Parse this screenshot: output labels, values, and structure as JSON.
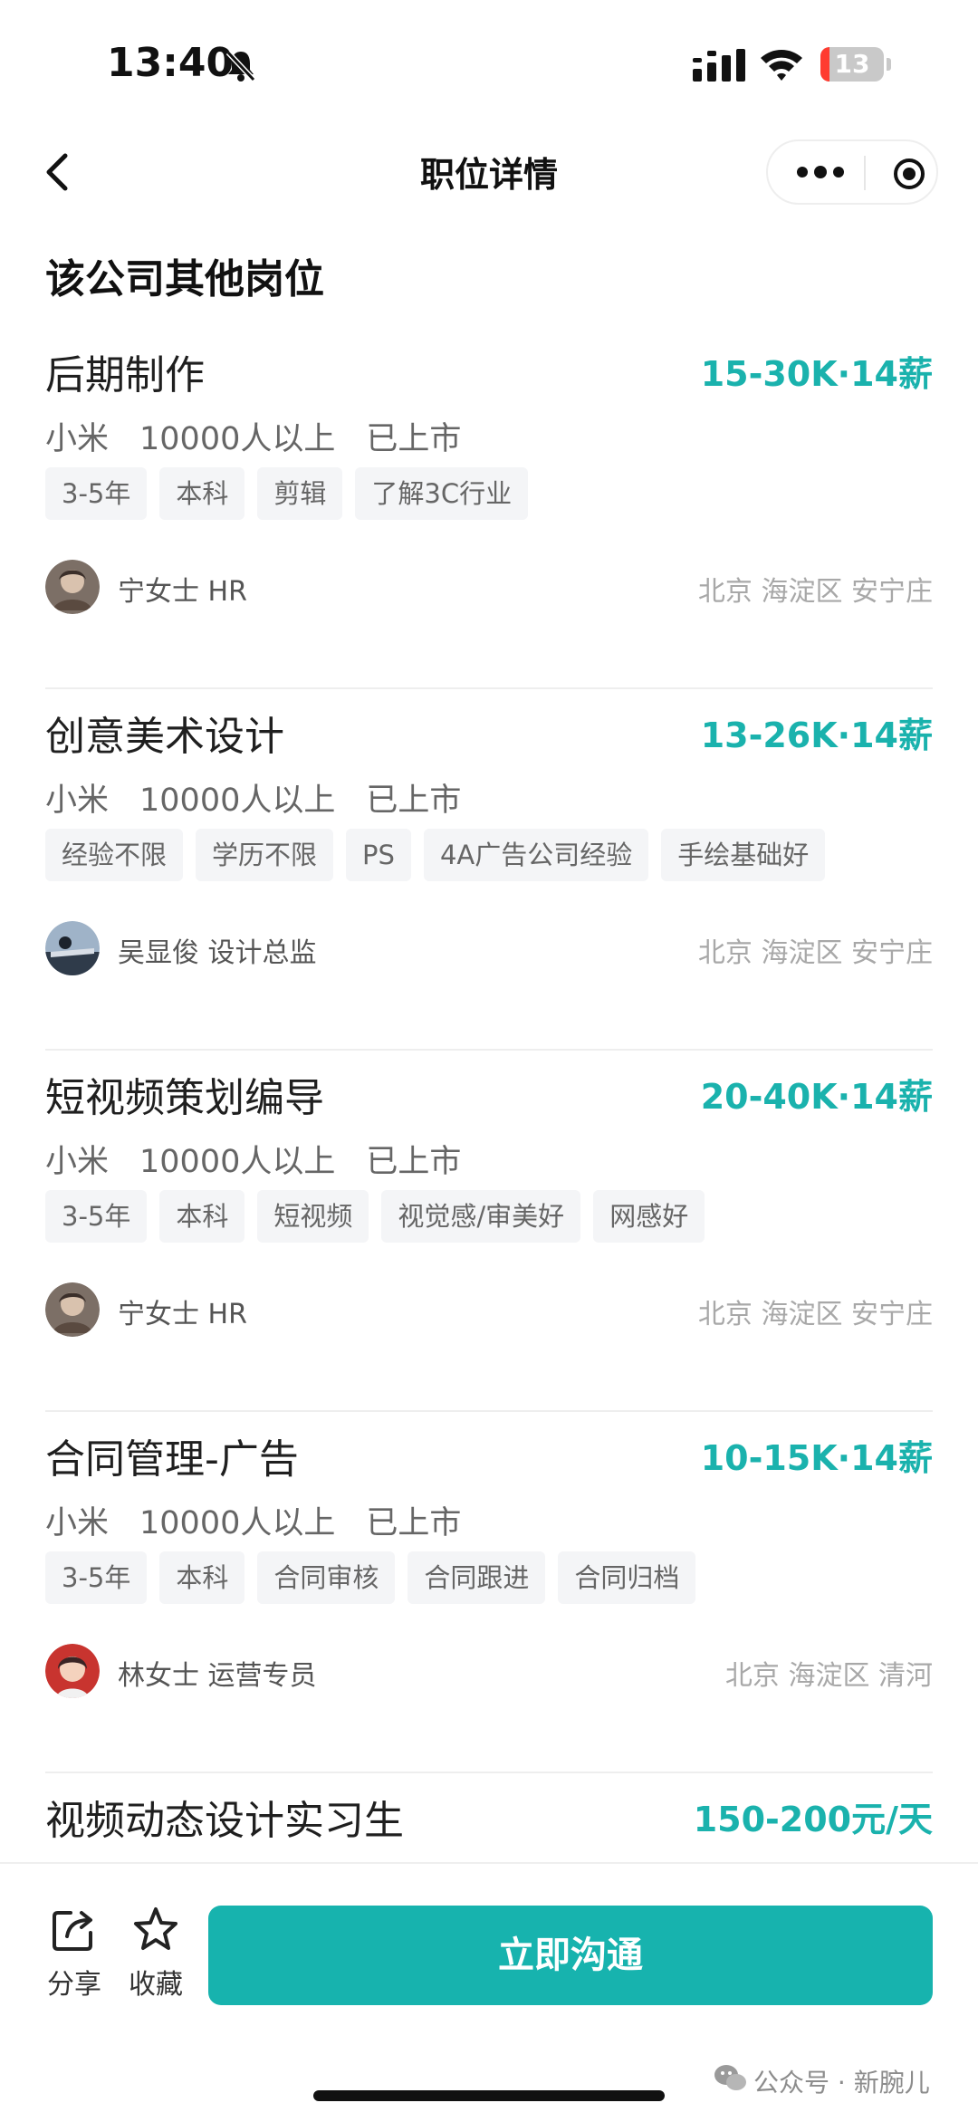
{
  "status_bar": {
    "time": "13:40",
    "battery": "13"
  },
  "nav": {
    "title": "职位详情"
  },
  "section": {
    "title": "该公司其他岗位"
  },
  "jobs": [
    {
      "title": "后期制作",
      "salary": "15-30K·14薪",
      "company": "小米",
      "size": "10000人以上",
      "stage": "已上市",
      "tags": [
        "3-5年",
        "本科",
        "剪辑",
        "了解3C行业"
      ],
      "recruiter": "宁女士 HR",
      "location": "北京 海淀区 安宁庄"
    },
    {
      "title": "创意美术设计",
      "salary": "13-26K·14薪",
      "company": "小米",
      "size": "10000人以上",
      "stage": "已上市",
      "tags": [
        "经验不限",
        "学历不限",
        "PS",
        "4A广告公司经验",
        "手绘基础好"
      ],
      "recruiter": "吴显俊 设计总监",
      "location": "北京 海淀区 安宁庄"
    },
    {
      "title": "短视频策划编导",
      "salary": "20-40K·14薪",
      "company": "小米",
      "size": "10000人以上",
      "stage": "已上市",
      "tags": [
        "3-5年",
        "本科",
        "短视频",
        "视觉感/审美好",
        "网感好"
      ],
      "recruiter": "宁女士 HR",
      "location": "北京 海淀区 安宁庄"
    },
    {
      "title": "合同管理-广告",
      "salary": "10-15K·14薪",
      "company": "小米",
      "size": "10000人以上",
      "stage": "已上市",
      "tags": [
        "3-5年",
        "本科",
        "合同审核",
        "合同跟进",
        "合同归档"
      ],
      "recruiter": "林女士 运营专员",
      "location": "北京 海淀区 清河"
    },
    {
      "title": "视频动态设计实习生",
      "salary": "150-200元/天"
    }
  ],
  "bottom": {
    "share_label": "分享",
    "favorite_label": "收藏",
    "chat_label": "立即沟通"
  },
  "watermark": "公众号 · 新腕儿",
  "colors": {
    "accent": "#1ab2ad",
    "button": "#17b3ae"
  }
}
